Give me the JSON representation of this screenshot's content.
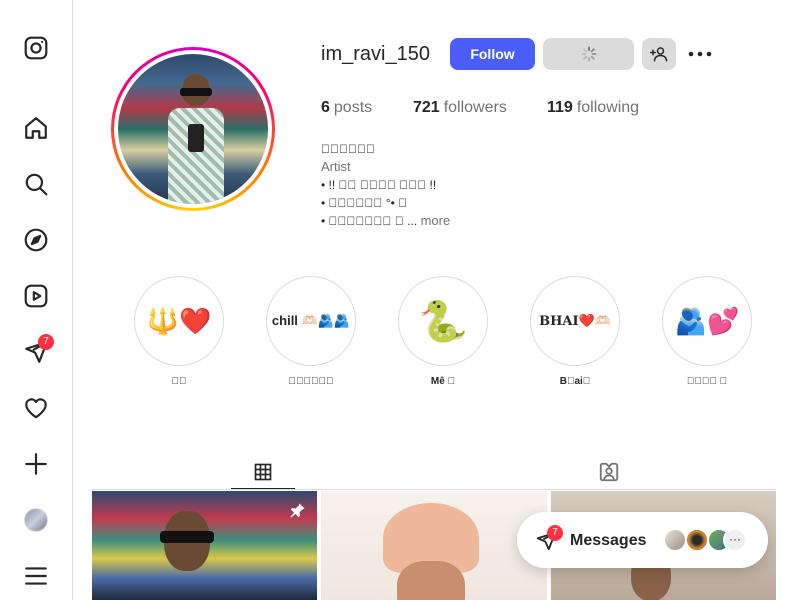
{
  "nav": {
    "items": [
      {
        "name": "instagram-logo-icon"
      },
      {
        "name": "home-icon"
      },
      {
        "name": "search-icon"
      },
      {
        "name": "explore-icon"
      },
      {
        "name": "reels-icon"
      },
      {
        "name": "messages-icon",
        "badge": "7"
      },
      {
        "name": "notifications-icon"
      },
      {
        "name": "create-icon"
      },
      {
        "name": "profile-avatar"
      },
      {
        "name": "menu-icon"
      }
    ],
    "messages_badge": "7"
  },
  "profile": {
    "username": "im_ravi_150",
    "follow_label": "Follow",
    "stats": {
      "posts_count": "6",
      "posts_label": "posts",
      "followers_count": "721",
      "followers_label": "followers",
      "following_count": "119",
      "following_label": "following"
    },
    "bio": {
      "name": "􀀀􀀀􀀀􀀀􀀀􀀀",
      "category": "Artist",
      "line1": "• !! 􀀀􀀀 􀀀􀀀􀀀􀀀 􀀀􀀀􀀀 !!",
      "line2": "• 􀀀􀀀􀀀􀀀􀀀􀀀 °• 􀀀",
      "line3": "• 􀀀􀀀􀀀􀀀􀀀􀀀􀀀 􀀀 ...",
      "more_label": "more"
    }
  },
  "highlights": [
    {
      "label": "􀀀􀀀",
      "content": "🔱❤️"
    },
    {
      "label": "􀀀􀀀􀀀􀀀􀀀􀀀",
      "content": "chill 🫶🏻🫂🫂"
    },
    {
      "label": "Mê 􀀀",
      "content": "🐍"
    },
    {
      "label": "B􀀀ai􀀀",
      "content": "BHAI❤️🫶🏻"
    },
    {
      "label": "􀀀􀀀􀀀􀀀 􀀀",
      "content": "🫂💕"
    }
  ],
  "messages_pill": {
    "label": "Messages",
    "badge": "7",
    "more": "···"
  },
  "colors": {
    "accent": "#4a5df9",
    "badge": "#ff3040",
    "border": "#dbdbdb",
    "muted_text": "#737373"
  }
}
